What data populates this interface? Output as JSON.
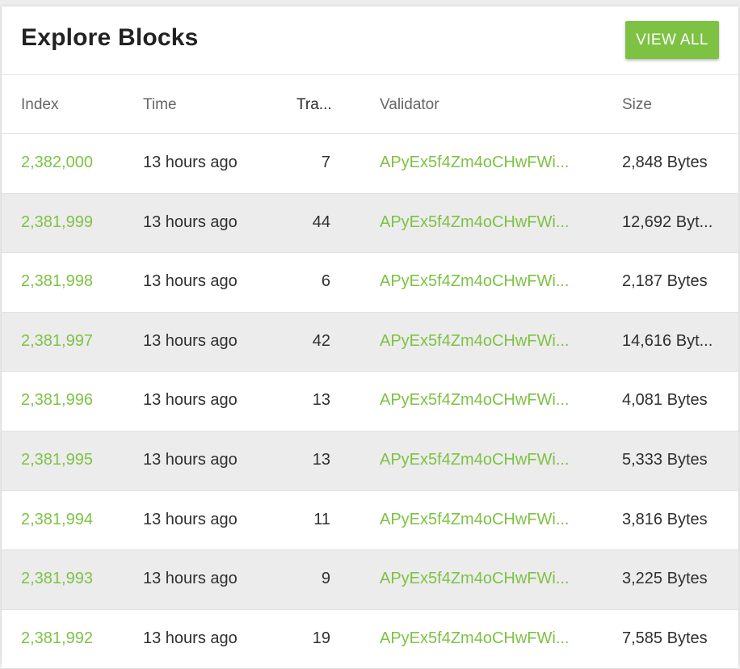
{
  "header": {
    "title": "Explore Blocks",
    "view_all_label": "VIEW ALL"
  },
  "colors": {
    "accent": "#7dc243",
    "row_alt": "#ececec",
    "text": "#2f2f2f",
    "header_text": "#666666"
  },
  "table": {
    "columns": [
      "Index",
      "Time",
      "Tra...",
      "Validator",
      "Size"
    ],
    "rows": [
      {
        "index": "2,382,000",
        "time": "13 hours ago",
        "tx": "7",
        "validator": "APyEx5f4Zm4oCHwFWi...",
        "size": "2,848 Bytes"
      },
      {
        "index": "2,381,999",
        "time": "13 hours ago",
        "tx": "44",
        "validator": "APyEx5f4Zm4oCHwFWi...",
        "size": "12,692 Byt..."
      },
      {
        "index": "2,381,998",
        "time": "13 hours ago",
        "tx": "6",
        "validator": "APyEx5f4Zm4oCHwFWi...",
        "size": "2,187 Bytes"
      },
      {
        "index": "2,381,997",
        "time": "13 hours ago",
        "tx": "42",
        "validator": "APyEx5f4Zm4oCHwFWi...",
        "size": "14,616 Byt..."
      },
      {
        "index": "2,381,996",
        "time": "13 hours ago",
        "tx": "13",
        "validator": "APyEx5f4Zm4oCHwFWi...",
        "size": "4,081 Bytes"
      },
      {
        "index": "2,381,995",
        "time": "13 hours ago",
        "tx": "13",
        "validator": "APyEx5f4Zm4oCHwFWi...",
        "size": "5,333 Bytes"
      },
      {
        "index": "2,381,994",
        "time": "13 hours ago",
        "tx": "11",
        "validator": "APyEx5f4Zm4oCHwFWi...",
        "size": "3,816 Bytes"
      },
      {
        "index": "2,381,993",
        "time": "13 hours ago",
        "tx": "9",
        "validator": "APyEx5f4Zm4oCHwFWi...",
        "size": "3,225 Bytes"
      },
      {
        "index": "2,381,992",
        "time": "13 hours ago",
        "tx": "19",
        "validator": "APyEx5f4Zm4oCHwFWi...",
        "size": "7,585 Bytes"
      }
    ]
  }
}
